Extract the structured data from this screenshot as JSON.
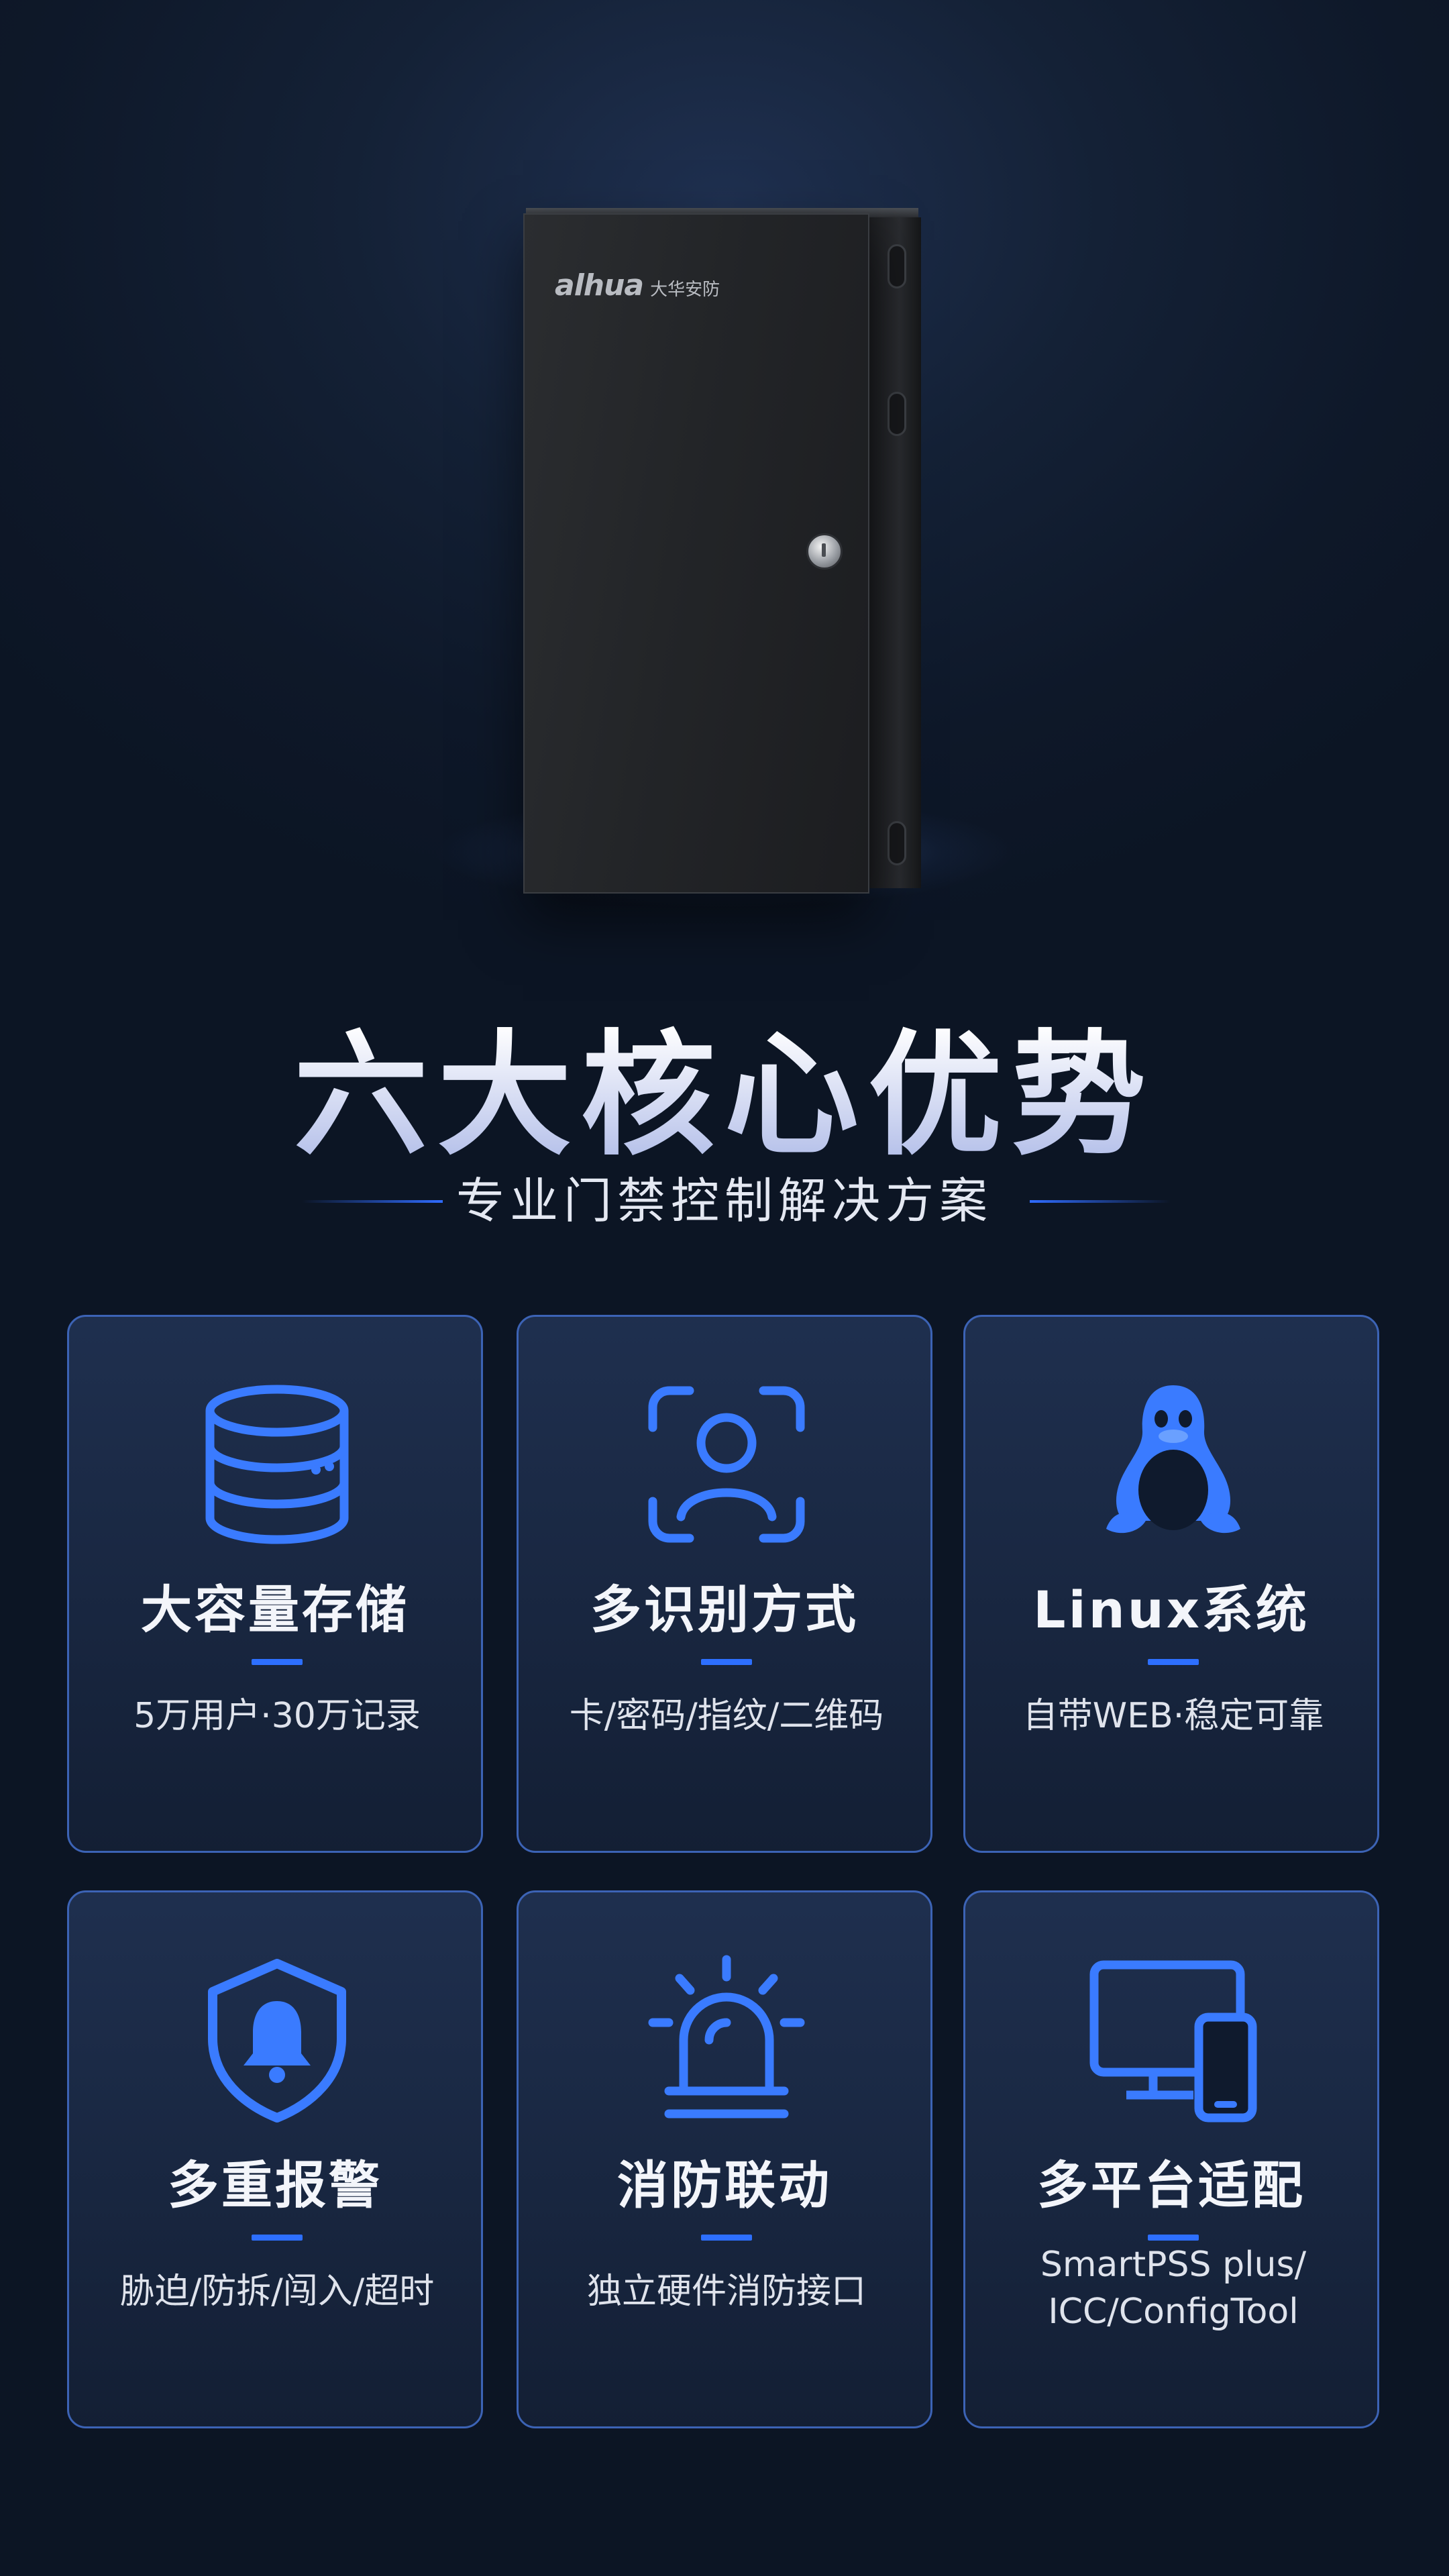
{
  "brand": {
    "logo_mark": "alhua",
    "logo_cn": "大华安防"
  },
  "heading": {
    "title": "六大核心优势",
    "subtitle": "专业门禁控制解决方案"
  },
  "colors": {
    "accent": "#2f6bff",
    "card_border": "#3c63b5",
    "icon_blue": "#3a7bff",
    "background": "#0e1829"
  },
  "features": [
    {
      "icon": "database-icon",
      "title": "大容量存储",
      "desc": "5万用户·30万记录"
    },
    {
      "icon": "face-scan-icon",
      "title": "多识别方式",
      "desc": "卡/密码/指纹/二维码"
    },
    {
      "icon": "linux-penguin-icon",
      "title": "Linux系统",
      "desc": "自带WEB·稳定可靠"
    },
    {
      "icon": "shield-bell-icon",
      "title": "多重报警",
      "desc": "胁迫/防拆/闯入/超时"
    },
    {
      "icon": "alarm-siren-icon",
      "title": "消防联动",
      "desc": "独立硬件消防接口"
    },
    {
      "icon": "monitor-phone-icon",
      "title": "多平台适配",
      "desc_line1": "SmartPSS plus/",
      "desc_line2": "ICC/ConfigTool"
    }
  ]
}
